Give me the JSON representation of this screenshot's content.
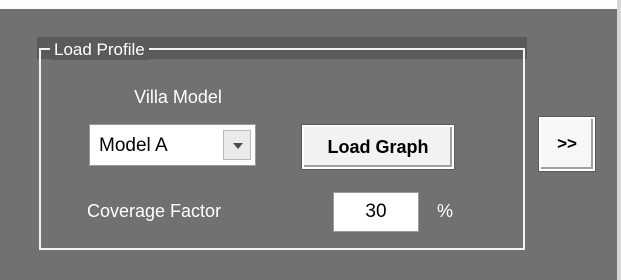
{
  "load_profile": {
    "group_title": "Load Profile",
    "villa_model_label": "Villa Model",
    "villa_model_selected": "Model A",
    "load_graph_label": "Load Graph",
    "coverage_factor_label": "Coverage Factor",
    "coverage_factor_value": "30",
    "coverage_unit": "%"
  },
  "expand_button_label": ">>",
  "icons": {
    "dropdown": "chevron-down-icon"
  },
  "colors": {
    "panel_background": "#717171",
    "header_bar": "#5a5a5a",
    "label_text": "#ffffff",
    "input_background": "#ffffff"
  }
}
